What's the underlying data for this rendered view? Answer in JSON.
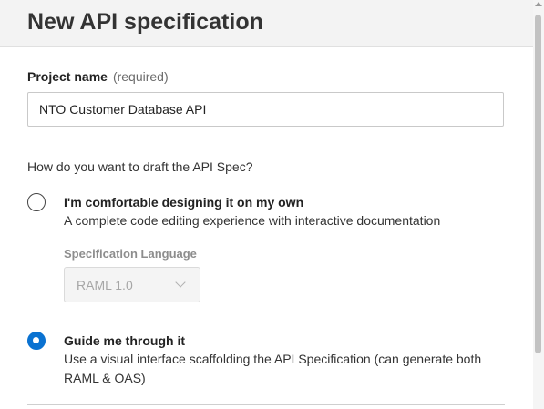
{
  "header": {
    "title": "New API specification"
  },
  "form": {
    "project_label": "Project name",
    "project_required": "(required)",
    "project_value": "NTO Customer Database API",
    "question": "How do you want to draft the API Spec?",
    "options": [
      {
        "title": "I'm comfortable designing it on my own",
        "description": "A complete code editing experience with interactive documentation",
        "selected": false
      },
      {
        "title": "Guide me through it",
        "description": "Use a visual interface scaffolding the API Specification (can generate both RAML & OAS)",
        "selected": true
      }
    ],
    "spec_language_label": "Specification Language",
    "spec_language_value": "RAML 1.0"
  },
  "colors": {
    "accent": "#0a72d1",
    "header_bg": "#f3f3f3"
  }
}
